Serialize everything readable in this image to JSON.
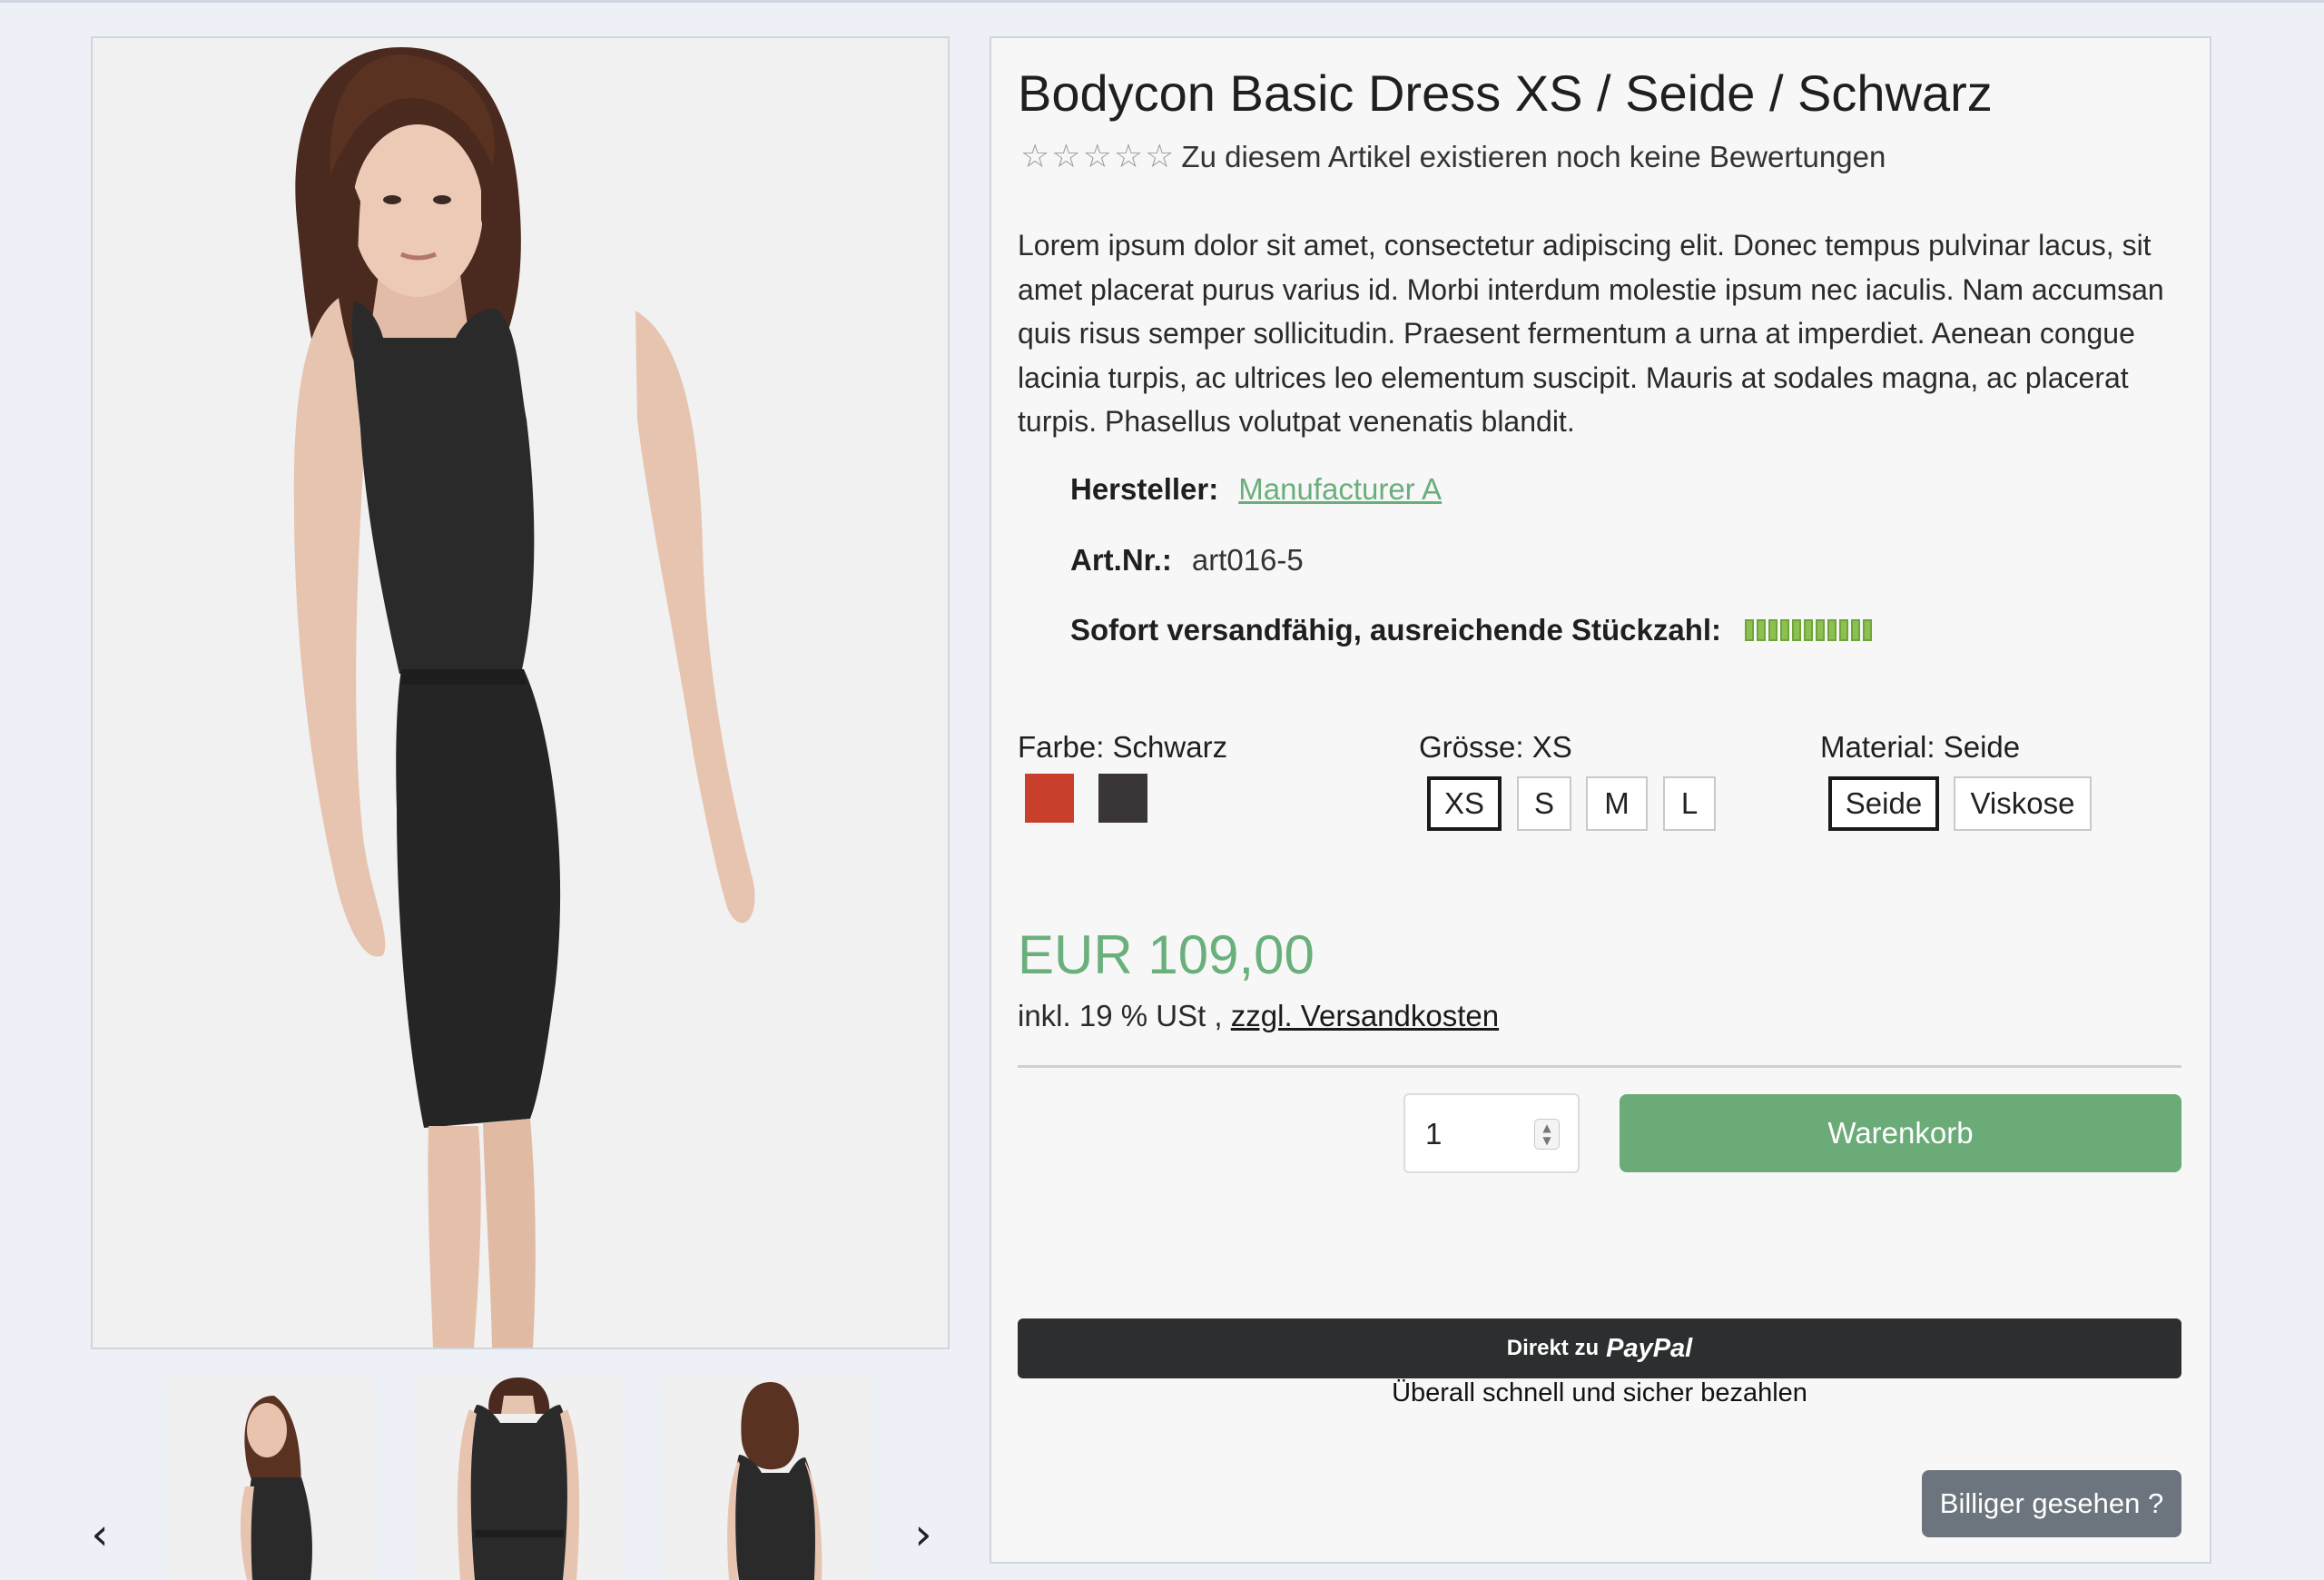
{
  "product": {
    "title": "Bodycon Basic Dress XS / Seide / Schwarz",
    "rating_stars": 0,
    "rating_text": "Zu diesem Artikel existieren noch keine Bewertungen",
    "description": "Lorem ipsum dolor sit amet, consectetur adipiscing elit. Donec tempus pulvinar lacus, sit amet placerat purus varius id. Morbi interdum molestie ipsum nec iaculis. Nam accumsan quis risus semper sollicitudin. Praesent fermentum a urna at imperdiet. Aenean congue lacinia turpis, ac ultrices leo elementum suscipit. Mauris at sodales magna, ac placerat turpis. Phasellus volutpat venenatis blandit.",
    "manufacturer_label": "Hersteller:",
    "manufacturer": "Manufacturer A",
    "sku_label": "Art.Nr.:",
    "sku": "art016-5",
    "stock_label": "Sofort versandfähig, ausreichende Stückzahl:",
    "stock_level": 1.0
  },
  "options": {
    "color": {
      "label": "Farbe: Schwarz",
      "swatches": [
        {
          "name": "Rot",
          "hex": "#c8402c"
        },
        {
          "name": "Schwarz",
          "hex": "#3a3638",
          "selected": true
        }
      ]
    },
    "size": {
      "label": "Grösse: XS",
      "values": [
        "XS",
        "S",
        "M",
        "L"
      ],
      "selected": "XS"
    },
    "material": {
      "label": "Material: Seide",
      "values": [
        "Seide",
        "Viskose"
      ],
      "selected": "Seide"
    }
  },
  "pricing": {
    "price": "EUR 109,00",
    "tax_prefix": "inkl. 19 % USt ,",
    "shipping_link": "zzgl. Versandkosten"
  },
  "cart": {
    "quantity": "1",
    "add_label": "Warenkorb"
  },
  "paypal": {
    "prefix": "Direkt zu",
    "logo": "PayPal",
    "subtext": "Überall schnell und sicher bezahlen"
  },
  "cheaper_label": "Billiger gesehen ?",
  "gallery": {
    "prev_icon": "chevron-left-icon",
    "next_icon": "chevron-right-icon",
    "thumbnails": [
      "back view",
      "front view",
      "side-back view"
    ]
  },
  "colors": {
    "accent_green": "#6aab77",
    "price_green": "#6ab07c",
    "link_green": "#6aae7c",
    "paypal_dark": "#2c2e2f",
    "cheaper_gray": "#6c747d"
  }
}
